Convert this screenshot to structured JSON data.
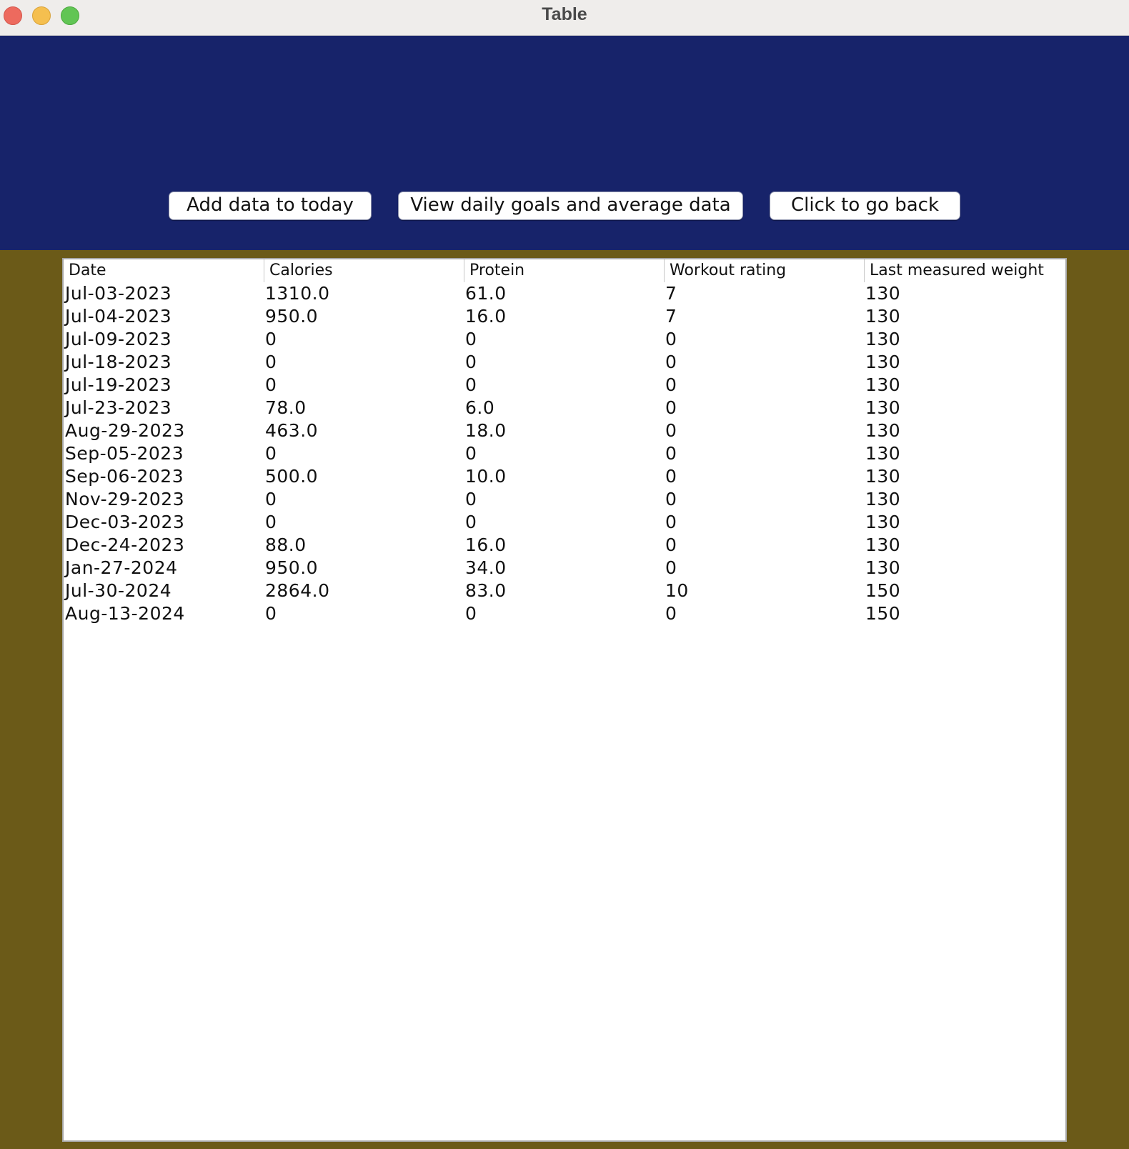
{
  "window": {
    "title": "Table"
  },
  "colors": {
    "top_panel": "#17236a",
    "background": "#6b5a18",
    "table_bg": "#ffffff"
  },
  "toolbar": {
    "add_label": "Add data to today",
    "view_label": "View daily goals and average data",
    "back_label": "Click to go back"
  },
  "table": {
    "columns": [
      "Date",
      "Calories",
      "Protein",
      "Workout rating",
      "Last measured weight"
    ],
    "rows": [
      [
        "Jul-03-2023",
        "1310.0",
        "61.0",
        "7",
        "130"
      ],
      [
        "Jul-04-2023",
        "950.0",
        "16.0",
        "7",
        "130"
      ],
      [
        "Jul-09-2023",
        "0",
        "0",
        "0",
        "130"
      ],
      [
        "Jul-18-2023",
        "0",
        "0",
        "0",
        "130"
      ],
      [
        "Jul-19-2023",
        "0",
        "0",
        "0",
        "130"
      ],
      [
        "Jul-23-2023",
        "78.0",
        "6.0",
        "0",
        "130"
      ],
      [
        "Aug-29-2023",
        "463.0",
        "18.0",
        "0",
        "130"
      ],
      [
        "Sep-05-2023",
        "0",
        "0",
        "0",
        "130"
      ],
      [
        "Sep-06-2023",
        "500.0",
        "10.0",
        "0",
        "130"
      ],
      [
        "Nov-29-2023",
        "0",
        "0",
        "0",
        "130"
      ],
      [
        "Dec-03-2023",
        "0",
        "0",
        "0",
        "130"
      ],
      [
        "Dec-24-2023",
        "88.0",
        "16.0",
        "0",
        "130"
      ],
      [
        "Jan-27-2024",
        "950.0",
        "34.0",
        "0",
        "130"
      ],
      [
        "Jul-30-2024",
        "2864.0",
        "83.0",
        "10",
        "150"
      ],
      [
        "Aug-13-2024",
        "0",
        "0",
        "0",
        "150"
      ]
    ]
  }
}
